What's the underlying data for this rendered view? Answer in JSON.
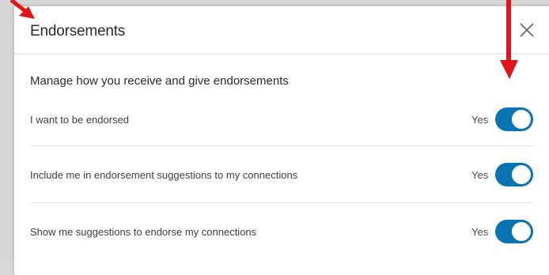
{
  "dialog": {
    "title": "Endorsements",
    "section_heading": "Manage how you receive and give endorsements",
    "close_icon": "close-icon"
  },
  "settings": [
    {
      "label": "I want to be endorsed",
      "status": "Yes",
      "enabled": true
    },
    {
      "label": "Include me in endorsement suggestions to my connections",
      "status": "Yes",
      "enabled": true
    },
    {
      "label": "Show me suggestions to endorse my connections",
      "status": "Yes",
      "enabled": true
    }
  ],
  "colors": {
    "toggle_on": "#0a73b1",
    "annotation_arrow": "#e0141b"
  }
}
